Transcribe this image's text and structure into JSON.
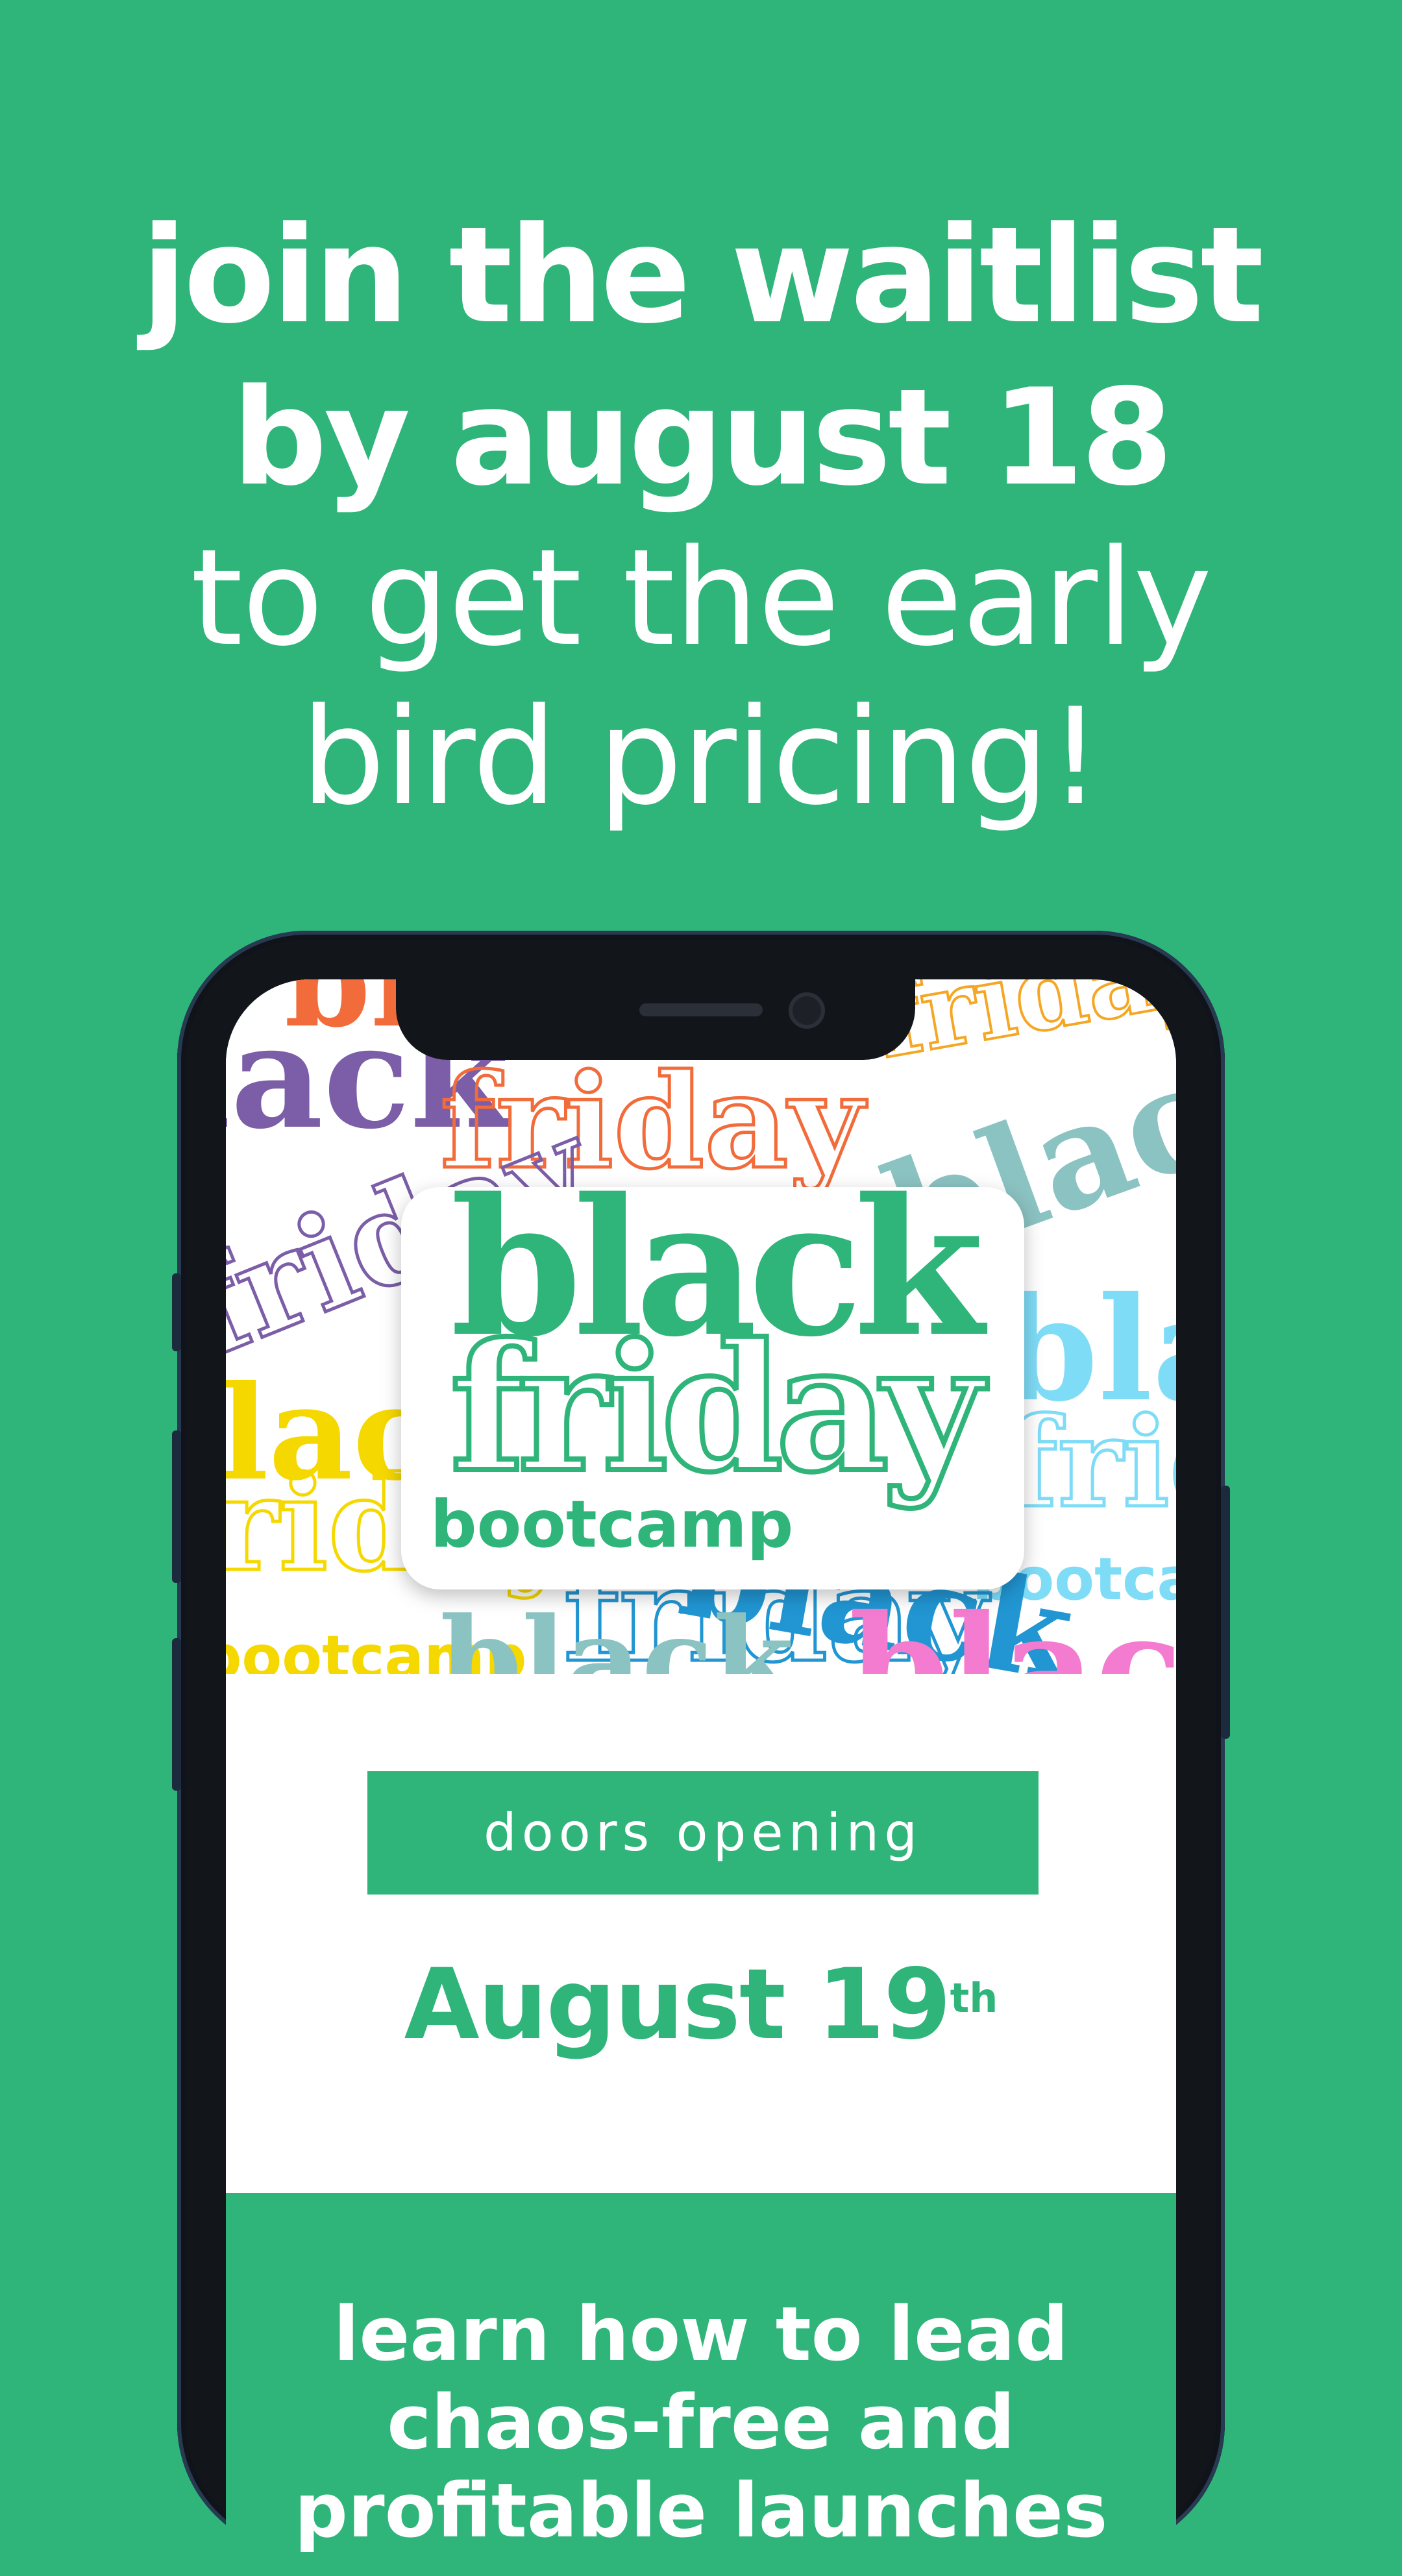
{
  "headline": {
    "line1": "join the waitlist",
    "line2": "by august 18",
    "line3": "to get the early",
    "line4": "bird pricing!"
  },
  "hero": {
    "logo_line1": "black",
    "logo_line2": "friday",
    "logo_line3": "bootcamp",
    "bg_stickers": [
      "black",
      "friday",
      "bootcamp"
    ],
    "sticker_colors": [
      "#f26b3a",
      "#7b5ea7",
      "#f5d800",
      "#8bc3c2",
      "#7fdcf7",
      "#2196d3",
      "#f47cd0",
      "#f5a623"
    ]
  },
  "doors": {
    "label": "doors opening"
  },
  "date": {
    "main": "August 19",
    "suffix": "th"
  },
  "learn": {
    "line1": "learn how to lead",
    "line2": "chaos-free and",
    "line3": "profitable launches"
  },
  "colors": {
    "brand_green": "#2fb57a",
    "white": "#ffffff",
    "phone_frame": "#12161b"
  }
}
